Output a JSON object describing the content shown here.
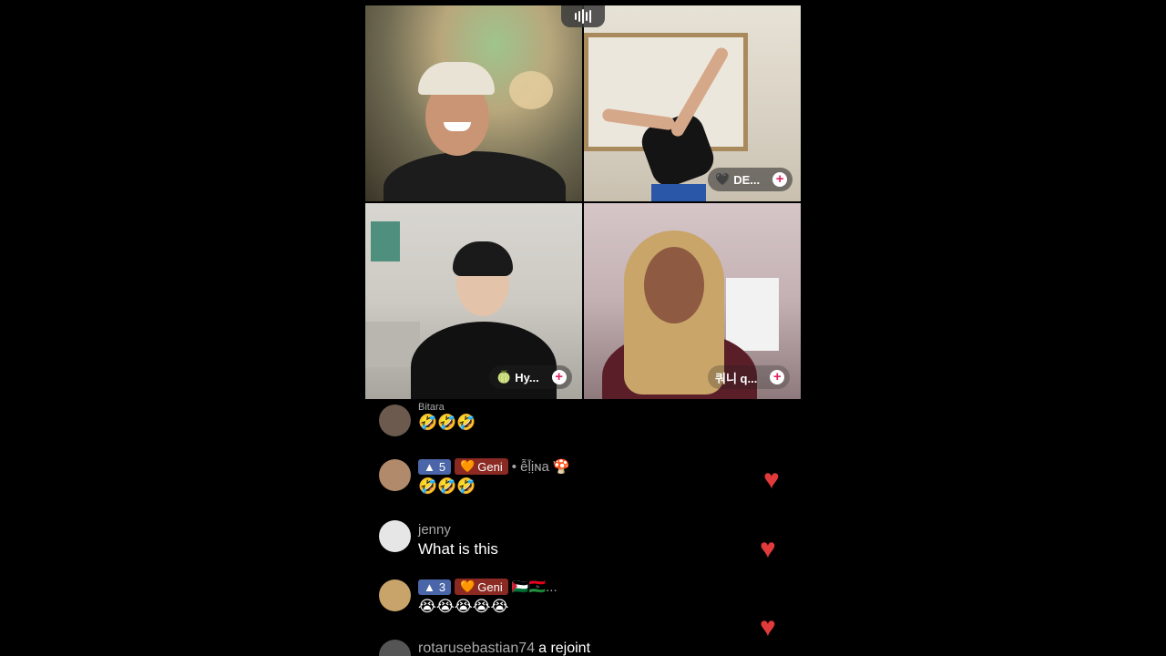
{
  "stream": {
    "participants": [
      {
        "name": "",
        "badge": ""
      },
      {
        "name": "DE...",
        "badge": "🖤"
      },
      {
        "name": "Hy...",
        "badge": "🍈"
      },
      {
        "name": "쿼니 q...",
        "badge": ""
      }
    ],
    "plus_symbol": "+"
  },
  "chat": {
    "messages": [
      {
        "username": "Bitara",
        "text": "🤣🤣🤣"
      },
      {
        "level": "5",
        "gift": "Geni",
        "username": "• ễḹịɴa ̛🍄",
        "text": "🤣🤣🤣"
      },
      {
        "username": "jenny",
        "text": "What is this"
      },
      {
        "level": "3",
        "gift": "Geni",
        "username": "🇵🇸🇱🇾...",
        "text": "😭😭😭😭😭"
      },
      {
        "username": "rotarusebastian74",
        "text": "a rejoint"
      }
    ],
    "level_icon": "▲",
    "gift_icon": "🧡",
    "heart_icon": "♥"
  },
  "colors": {
    "heart": "#e03a3a",
    "level_badge": "#4a65a8",
    "gift_badge": "#8a2a22"
  }
}
